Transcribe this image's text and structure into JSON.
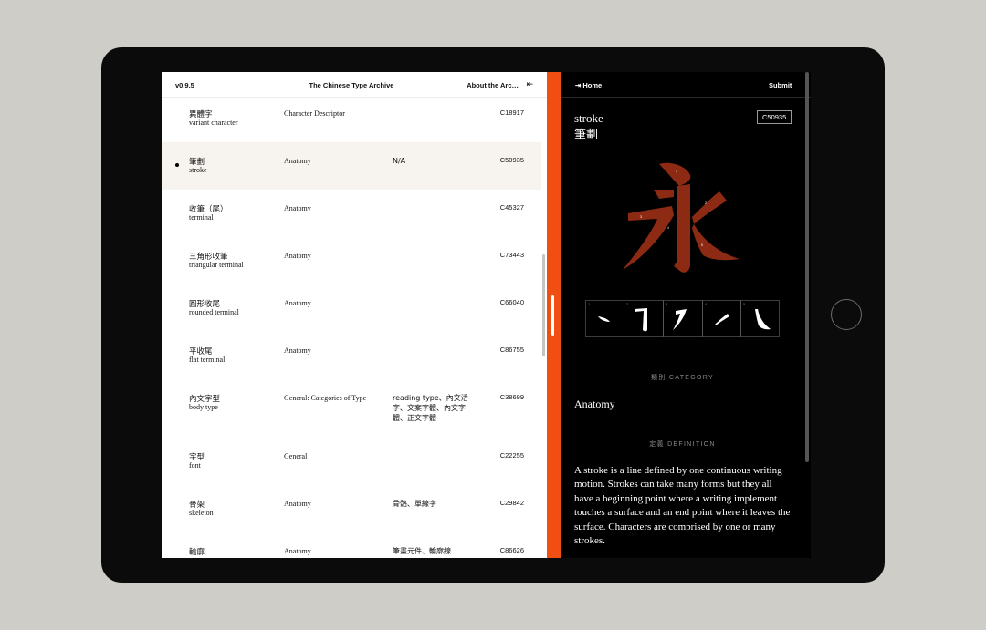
{
  "app": {
    "version": "v0.9.5",
    "title": "The Chinese Type Archive",
    "about_label": "About the Arc…",
    "collapse_icon": "⇤"
  },
  "entries": [
    {
      "zh": "異體字",
      "en": "variant character",
      "category": "Character Descriptor",
      "related": "",
      "code": "C18917"
    },
    {
      "zh": "筆劃",
      "en": "stroke",
      "category": "Anatomy",
      "related": "N/A",
      "code": "C50935"
    },
    {
      "zh": "收筆（尾）",
      "en": "terminal",
      "category": "Anatomy",
      "related": "",
      "code": "C45327"
    },
    {
      "zh": "三角形收筆",
      "en": "triangular terminal",
      "category": "Anatomy",
      "related": "",
      "code": "C73443"
    },
    {
      "zh": "圓形收尾",
      "en": "rounded terminal",
      "category": "Anatomy",
      "related": "",
      "code": "C66040"
    },
    {
      "zh": "平收尾",
      "en": "flat terminal",
      "category": "Anatomy",
      "related": "",
      "code": "C86755"
    },
    {
      "zh": "內文字型",
      "en": "body type",
      "category": "General: Categories of Type",
      "related": "reading type、內文活字、文案字體、內文字體、正文字體",
      "code": "C38699"
    },
    {
      "zh": "字型",
      "en": "font",
      "category": "General",
      "related": "",
      "code": "C22255"
    },
    {
      "zh": "骨架",
      "en": "skeleton",
      "category": "Anatomy",
      "related": "骨骼、單線字",
      "code": "C29842"
    },
    {
      "zh": "輪廓",
      "en": "",
      "category": "Anatomy",
      "related": "筆畫元件、輪廓線",
      "code": "C86626"
    }
  ],
  "detail": {
    "home_label": "⇥  Home",
    "submit_label": "Submit",
    "term_en": "stroke",
    "term_zh": "筆劃",
    "code": "C50935",
    "category_label": "類別 CATEGORY",
    "category_value": "Anatomy",
    "definition_label": "定義 DEFINITION",
    "definition": "A stroke is a line defined by one continuous writing motion. Strokes can take many forms but they all have a beginning point where a writing implement touches a surface and an end point where it leaves the surface. Characters are comprised by one or many strokes.",
    "stroke_numbers": [
      "1",
      "2",
      "3",
      "4",
      "5"
    ]
  },
  "colors": {
    "accent": "#f04e12",
    "glyph": "#8c2a14",
    "selected_row": "#f7f4ef"
  }
}
